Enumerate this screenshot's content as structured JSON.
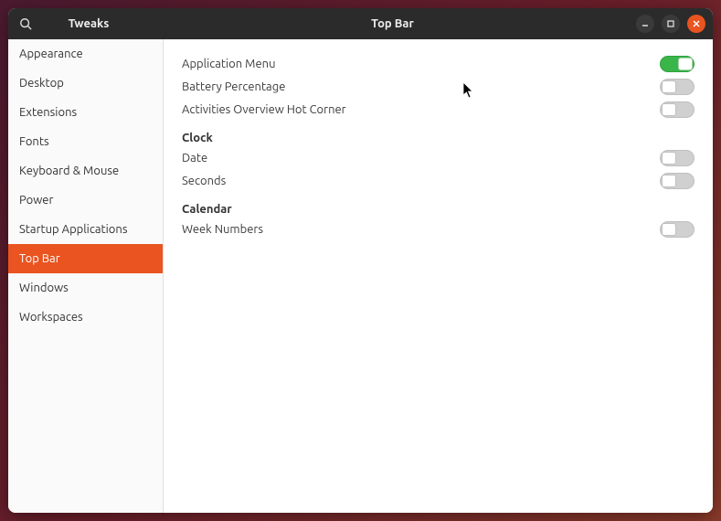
{
  "app": {
    "title": "Tweaks"
  },
  "header": {
    "page_title": "Top Bar"
  },
  "sidebar": {
    "active_index": 7,
    "items": [
      {
        "id": "appearance",
        "label": "Appearance"
      },
      {
        "id": "desktop",
        "label": "Desktop"
      },
      {
        "id": "extensions",
        "label": "Extensions"
      },
      {
        "id": "fonts",
        "label": "Fonts"
      },
      {
        "id": "keyboard-mouse",
        "label": "Keyboard & Mouse"
      },
      {
        "id": "power",
        "label": "Power"
      },
      {
        "id": "startup-applications",
        "label": "Startup Applications"
      },
      {
        "id": "top-bar",
        "label": "Top Bar"
      },
      {
        "id": "windows",
        "label": "Windows"
      },
      {
        "id": "workspaces",
        "label": "Workspaces"
      }
    ]
  },
  "content": {
    "general": {
      "rows": [
        {
          "id": "application-menu",
          "label": "Application Menu",
          "value": true
        },
        {
          "id": "battery-percentage",
          "label": "Battery Percentage",
          "value": false
        },
        {
          "id": "activities-hot-corner",
          "label": "Activities Overview Hot Corner",
          "value": false
        }
      ]
    },
    "clock": {
      "title": "Clock",
      "rows": [
        {
          "id": "date",
          "label": "Date",
          "value": false
        },
        {
          "id": "seconds",
          "label": "Seconds",
          "value": false
        }
      ]
    },
    "calendar": {
      "title": "Calendar",
      "rows": [
        {
          "id": "week-numbers",
          "label": "Week Numbers",
          "value": false
        }
      ]
    }
  },
  "colors": {
    "accent": "#e95420",
    "toggle_on": "#39b54a"
  }
}
